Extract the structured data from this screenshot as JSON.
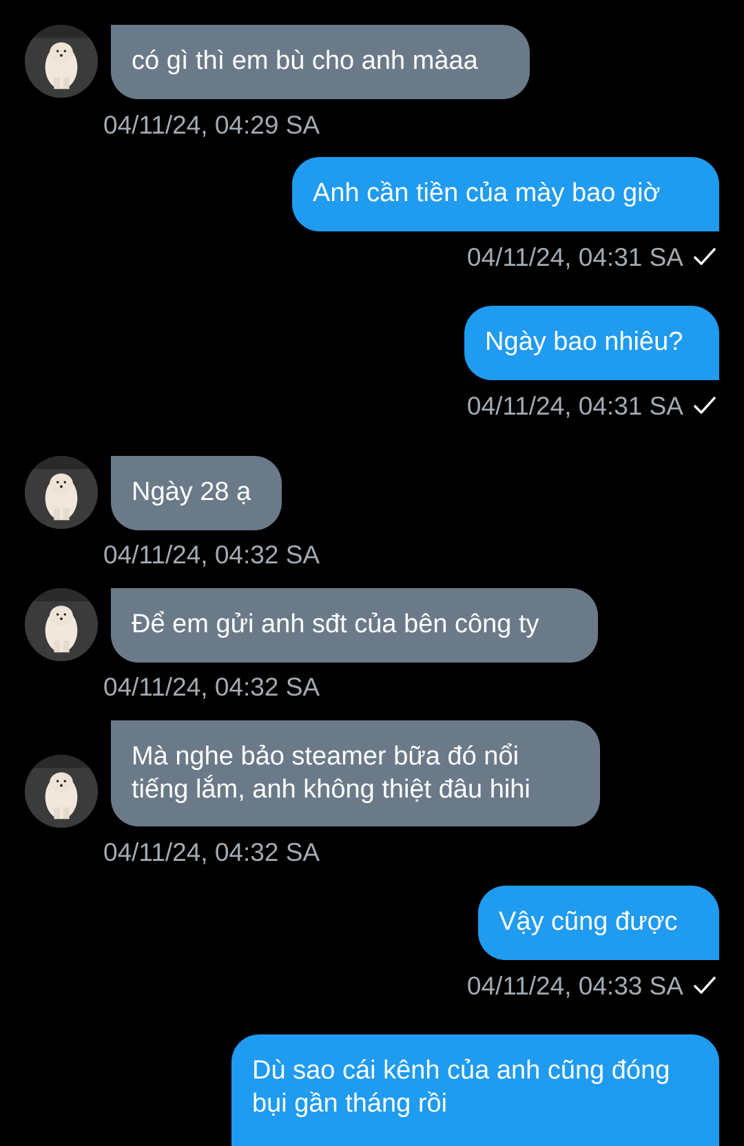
{
  "conversation": {
    "messages": [
      {
        "direction": "in",
        "text": "có gì thì em bù cho anh màaa",
        "time": "04/11/24, 04:29 SA"
      },
      {
        "direction": "out",
        "text": "Anh cần tiền của mày bao giờ",
        "time": "04/11/24, 04:31 SA",
        "status_icon": "checkmark-icon"
      },
      {
        "direction": "out",
        "text": "Ngày bao nhiêu?",
        "time": "04/11/24, 04:31 SA",
        "status_icon": "checkmark-icon"
      },
      {
        "direction": "in",
        "text": "Ngày 28 ạ",
        "time": "04/11/24, 04:32 SA"
      },
      {
        "direction": "in",
        "text": "Để em gửi anh sđt của bên công ty",
        "time": "04/11/24, 04:32 SA"
      },
      {
        "direction": "in",
        "text": "Mà nghe bảo steamer bữa đó nổi tiếng lắm, anh không thiệt đâu hihi",
        "time": "04/11/24, 04:32 SA"
      },
      {
        "direction": "out",
        "text": "Vậy cũng được",
        "time": "04/11/24, 04:33 SA",
        "status_icon": "checkmark-icon"
      },
      {
        "direction": "out",
        "text": "Dù sao cái kênh của anh cũng đóng bụi gần tháng rồi",
        "time": "",
        "status_icon": ""
      }
    ]
  },
  "colors": {
    "background": "#000000",
    "incoming_bubble": "#6b7a89",
    "outgoing_bubble": "#1f9bf0",
    "timestamp": "#a3acb5",
    "text": "#ffffff"
  },
  "icons": {
    "avatar": "dog-avatar-icon",
    "read_status": "checkmark-icon"
  }
}
